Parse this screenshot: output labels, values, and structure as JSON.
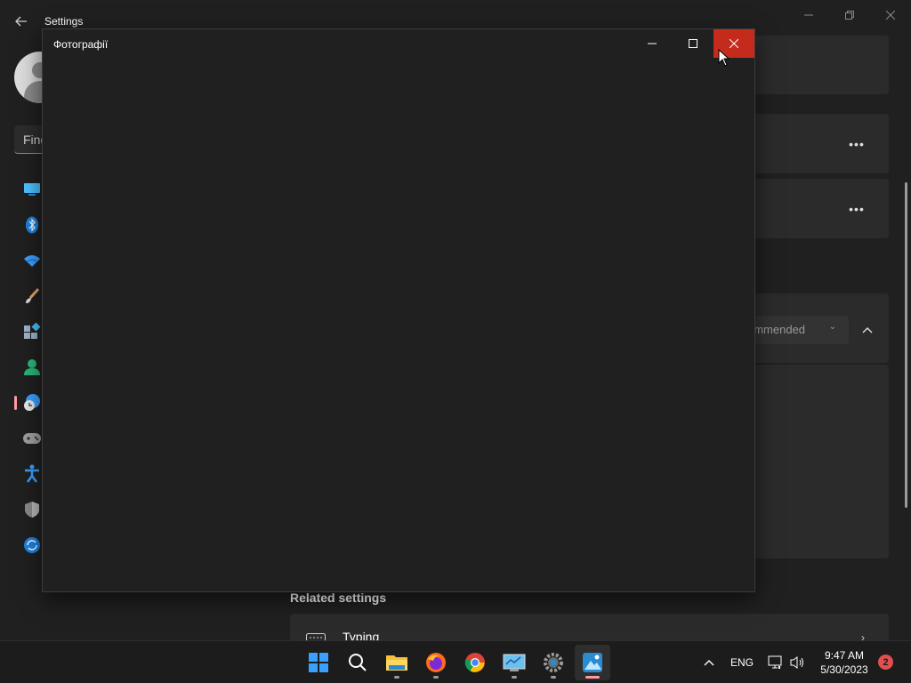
{
  "settings_window": {
    "title": "Settings",
    "search_placeholder": "Find",
    "dropdown_value": "ommended",
    "related_settings_heading": "Related settings",
    "typing_label": "Typing"
  },
  "photos_window": {
    "title": "Фотографії"
  },
  "taskbar": {
    "apps": [
      {
        "name": "start",
        "icon": "windows-start-icon",
        "active": false
      },
      {
        "name": "search",
        "icon": "search-icon",
        "active": false
      },
      {
        "name": "file-explorer",
        "icon": "folder-icon",
        "active": false
      },
      {
        "name": "firefox",
        "icon": "firefox-icon",
        "active": false
      },
      {
        "name": "chrome",
        "icon": "chrome-icon",
        "active": false
      },
      {
        "name": "control-panel",
        "icon": "control-panel-icon",
        "active": false
      },
      {
        "name": "settings",
        "icon": "gear-icon",
        "active": false
      },
      {
        "name": "photos",
        "icon": "photos-icon",
        "active": true
      }
    ],
    "language": "ENG",
    "time": "9:47 AM",
    "date": "5/30/2023",
    "notification_count": "2"
  },
  "colors": {
    "accent": "#ff99a4",
    "close_hover": "#c42b1c",
    "window_bg": "#202020",
    "card_bg": "#2b2b2b",
    "taskbar_bg": "#1c1c1c"
  }
}
